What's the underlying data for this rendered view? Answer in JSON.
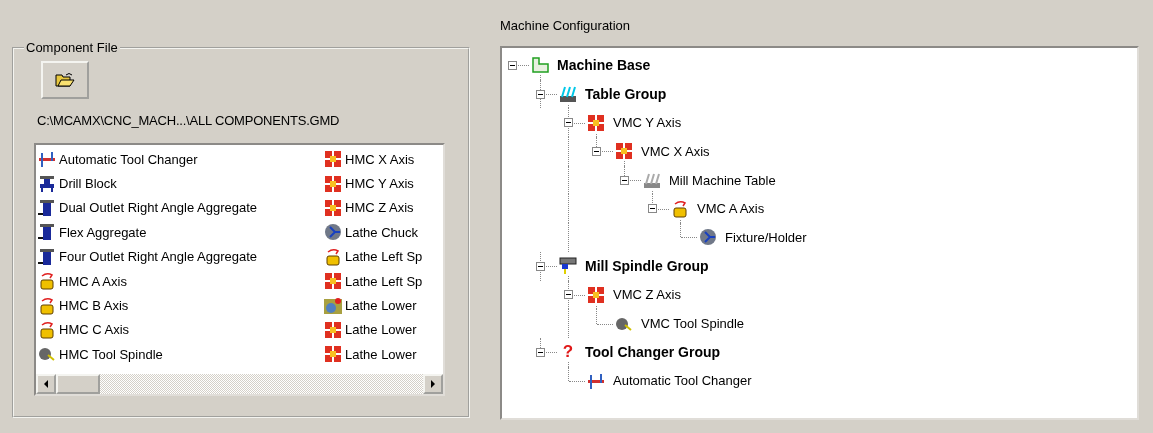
{
  "component_file": {
    "legend": "Component File",
    "path": "C:\\MCAMX\\CNC_MACH...\\ALL COMPONENTS.GMD",
    "items": [
      {
        "label": "Automatic Tool Changer",
        "kind": "tool-changer"
      },
      {
        "label": "Drill Block",
        "kind": "drill-block"
      },
      {
        "label": "Dual Outlet Right Angle Aggregate",
        "kind": "aggregate"
      },
      {
        "label": "Flex Aggregate",
        "kind": "aggregate"
      },
      {
        "label": "Four Outlet Right Angle Aggregate",
        "kind": "aggregate"
      },
      {
        "label": "HMC A Axis",
        "kind": "rotary-axis"
      },
      {
        "label": "HMC B Axis",
        "kind": "rotary-axis"
      },
      {
        "label": "HMC C Axis",
        "kind": "rotary-axis"
      },
      {
        "label": "HMC Tool Spindle",
        "kind": "tool-spindle"
      },
      {
        "label": "HMC X Axis",
        "kind": "linear-axis"
      },
      {
        "label": "HMC Y Axis",
        "kind": "linear-axis"
      },
      {
        "label": "HMC Z Axis",
        "kind": "linear-axis"
      },
      {
        "label": "Lathe Chuck",
        "kind": "chuck"
      },
      {
        "label": "Lathe Left Sp",
        "kind": "rotary-axis"
      },
      {
        "label": "Lathe Left Sp",
        "kind": "linear-axis"
      },
      {
        "label": "Lathe Lower",
        "kind": "lathe-tool"
      },
      {
        "label": "Lathe Lower",
        "kind": "linear-axis"
      },
      {
        "label": "Lathe Lower",
        "kind": "linear-axis"
      }
    ]
  },
  "machine_configuration": {
    "title": "Machine Configuration",
    "tree": [
      {
        "label": "Machine Base",
        "kind": "machine-base",
        "bold": true,
        "expanded": true,
        "children": [
          {
            "label": "Table Group",
            "kind": "table-group",
            "bold": true,
            "expanded": true,
            "children": [
              {
                "label": "VMC Y Axis",
                "kind": "linear-axis",
                "bold": false,
                "expanded": true,
                "children": [
                  {
                    "label": "VMC X Axis",
                    "kind": "linear-axis",
                    "bold": false,
                    "expanded": true,
                    "children": [
                      {
                        "label": "Mill Machine Table",
                        "kind": "machine-table",
                        "bold": false,
                        "expanded": true,
                        "children": [
                          {
                            "label": "VMC A Axis",
                            "kind": "rotary-axis",
                            "bold": false,
                            "expanded": true,
                            "children": [
                              {
                                "label": "Fixture/Holder",
                                "kind": "chuck",
                                "bold": false
                              }
                            ]
                          }
                        ]
                      }
                    ]
                  }
                ]
              }
            ]
          },
          {
            "label": "Mill Spindle Group",
            "kind": "spindle-group",
            "bold": true,
            "expanded": true,
            "children": [
              {
                "label": "VMC Z Axis",
                "kind": "linear-axis",
                "bold": false,
                "expanded": true,
                "children": [
                  {
                    "label": "VMC Tool Spindle",
                    "kind": "tool-spindle",
                    "bold": false
                  }
                ]
              }
            ]
          },
          {
            "label": "Tool Changer Group",
            "kind": "unknown",
            "icon_text": "?",
            "bold": true,
            "expanded": true,
            "children": [
              {
                "label": "Automatic Tool Changer",
                "kind": "tool-changer",
                "bold": false
              }
            ]
          }
        ]
      }
    ]
  }
}
